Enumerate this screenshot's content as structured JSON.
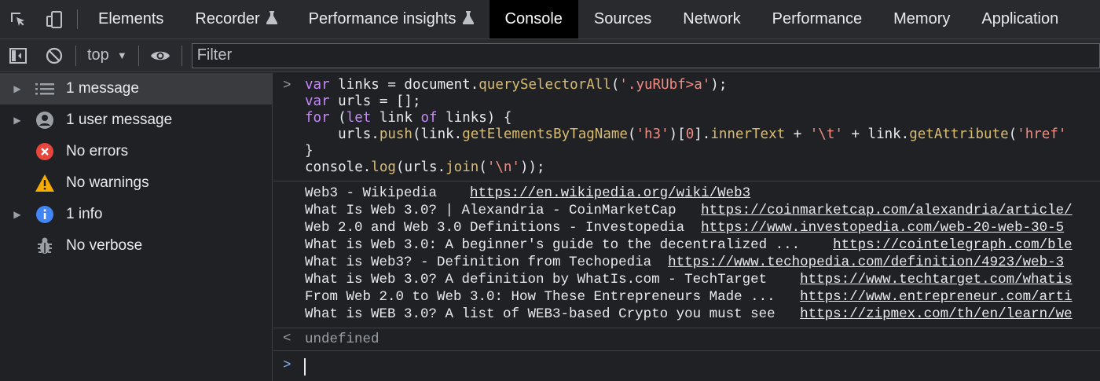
{
  "tabs": [
    {
      "label": "Elements",
      "flask": false
    },
    {
      "label": "Recorder",
      "flask": true
    },
    {
      "label": "Performance insights",
      "flask": true
    },
    {
      "label": "Console",
      "flask": false,
      "active": true
    },
    {
      "label": "Sources",
      "flask": false
    },
    {
      "label": "Network",
      "flask": false
    },
    {
      "label": "Performance",
      "flask": false
    },
    {
      "label": "Memory",
      "flask": false
    },
    {
      "label": "Application",
      "flask": false
    }
  ],
  "toolbar": {
    "context": "top",
    "filter_placeholder": "Filter"
  },
  "sidebar": {
    "items": [
      {
        "label": "1 message",
        "icon": "list-icon",
        "expandable": true,
        "selected": true
      },
      {
        "label": "1 user message",
        "icon": "user-icon",
        "expandable": true
      },
      {
        "label": "No errors",
        "icon": "error-icon",
        "expandable": false
      },
      {
        "label": "No warnings",
        "icon": "warning-icon",
        "expandable": false
      },
      {
        "label": "1 info",
        "icon": "info-icon",
        "expandable": true
      },
      {
        "label": "No verbose",
        "icon": "bug-icon",
        "expandable": false
      }
    ]
  },
  "console": {
    "input_prompt": ">",
    "result_prompt": "<",
    "code_lines": [
      "var links = document.querySelectorAll('.yuRUbf>a');",
      "var urls = [];",
      "for (let link of links) {",
      "    urls.push(link.getElementsByTagName('h3')[0].innerText + '\\t' + link.getAttribute('href'",
      "}",
      "console.log(urls.join('\\n'));"
    ],
    "output": [
      {
        "title": "Web3 - Wikipedia    ",
        "url": "https://en.wikipedia.org/wiki/Web3"
      },
      {
        "title": "What Is Web 3.0? | Alexandria - CoinMarketCap   ",
        "url": "https://coinmarketcap.com/alexandria/article/"
      },
      {
        "title": "Web 2.0 and Web 3.0 Definitions - Investopedia  ",
        "url": "https://www.investopedia.com/web-20-web-30-5"
      },
      {
        "title": "What is Web 3.0: A beginner's guide to the decentralized ...    ",
        "url": "https://cointelegraph.com/ble"
      },
      {
        "title": "What is Web3? - Definition from Techopedia  ",
        "url": "https://www.techopedia.com/definition/4923/web-3"
      },
      {
        "title": "What is Web 3.0? A definition by WhatIs.com - TechTarget    ",
        "url": "https://www.techtarget.com/whatis"
      },
      {
        "title": "From Web 2.0 to Web 3.0: How These Entrepreneurs Made ...   ",
        "url": "https://www.entrepreneur.com/arti"
      },
      {
        "title": "What is WEB 3.0? A list of WEB3-based Crypto you must see   ",
        "url": "https://zipmex.com/th/en/learn/we"
      }
    ],
    "result": "undefined"
  },
  "colors": {
    "accent": "#8ab4f8",
    "error": "#e8453c",
    "warning": "#f9ab00",
    "info": "#4285f4"
  }
}
